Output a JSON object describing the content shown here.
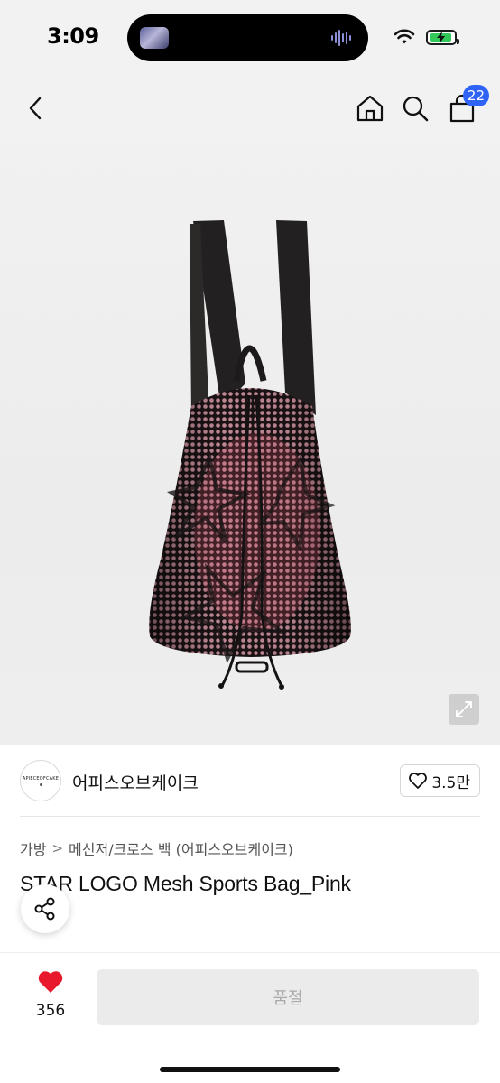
{
  "status_bar": {
    "time": "3:09"
  },
  "nav": {
    "cart_count": "22"
  },
  "brand": {
    "logo_text": "APIECEOFCAKE",
    "name": "어피스오브케이크",
    "like_count": "3.5만"
  },
  "breadcrumb": {
    "level1": "가방",
    "separator": ">",
    "level2": "메신저/크로스 백 (어피스오브케이크)"
  },
  "product": {
    "title": "STAR LOGO Mesh Sports Bag_Pink"
  },
  "bottom_bar": {
    "wish_count": "356",
    "buy_button_label": "품절"
  },
  "colors": {
    "accent_badge": "#2f63f5",
    "heart": "#e8192c",
    "battery": "#34c759",
    "soldout_bg": "#ebebeb"
  },
  "icons": [
    "back-icon",
    "home-icon",
    "search-icon",
    "cart-icon",
    "expand-icon",
    "heart-outline-icon",
    "share-icon",
    "heart-filled-icon"
  ]
}
